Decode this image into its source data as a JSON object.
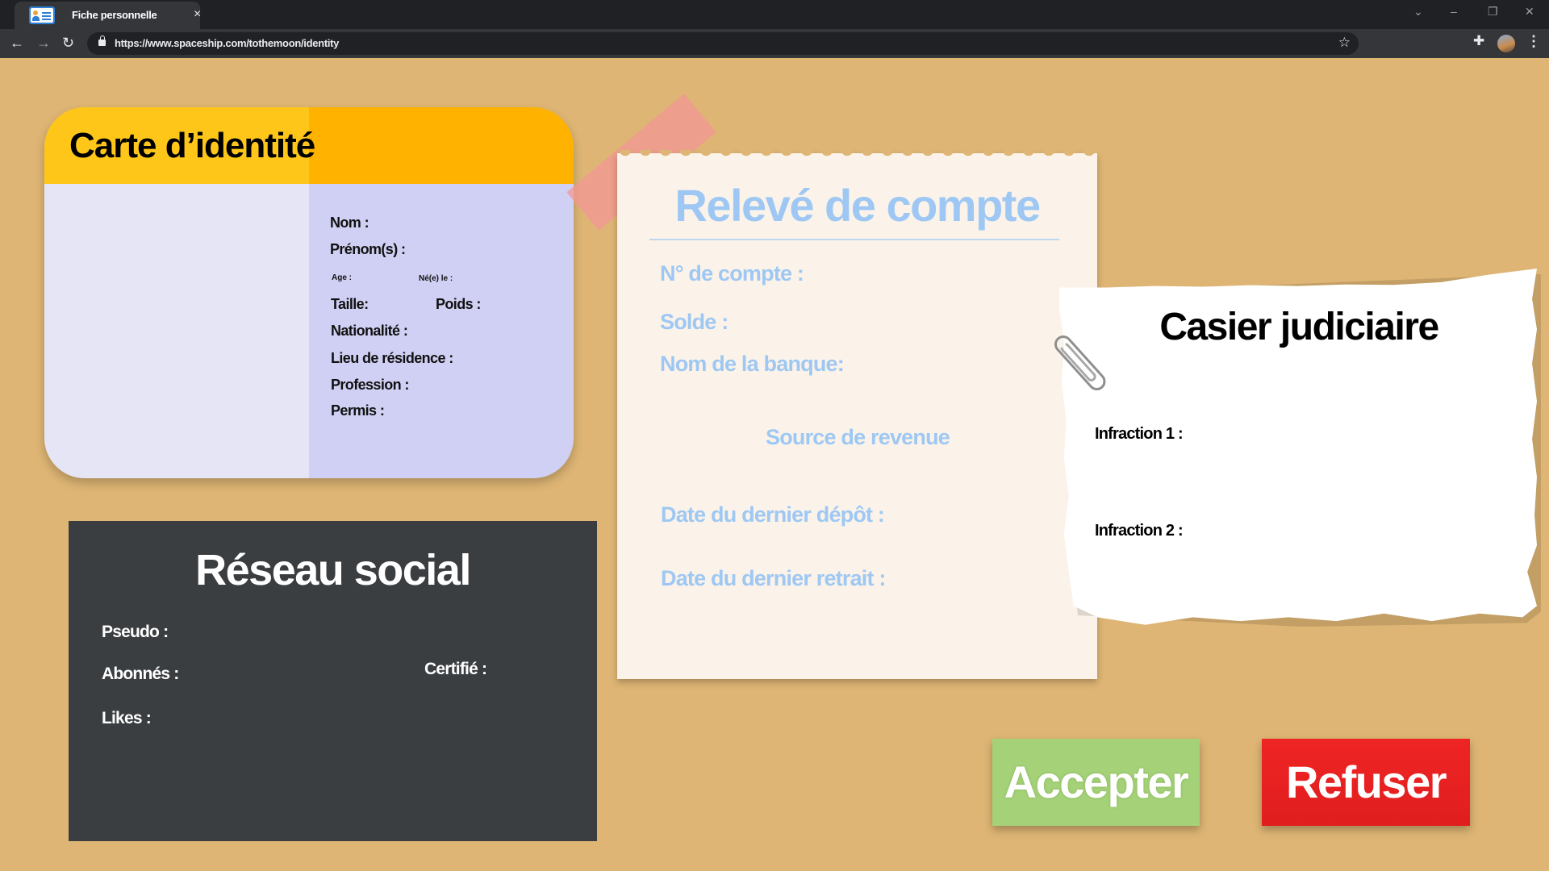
{
  "browser": {
    "tab_title": "Fiche personnelle",
    "tab_close": "×",
    "url": "https://www.spaceship.com/tothemoon/identity",
    "window_controls": {
      "chevron": "⌄",
      "minimize": "–",
      "restore": "❐",
      "close": "✕"
    },
    "nav": {
      "back": "←",
      "forward": "→",
      "reload": "↻"
    },
    "icons": {
      "star": "☆",
      "extensions": "✚",
      "menu": "⋮"
    }
  },
  "identity_card": {
    "title": "Carte d’identité",
    "labels": {
      "nom": "Nom :",
      "prenoms": "Prénom(s) :",
      "age": "Age :",
      "ne_le": "Né(e) le :",
      "taille": "Taille:",
      "poids": "Poids :",
      "nationalite": "Nationalité :",
      "lieu": "Lieu de résidence :",
      "profession": "Profession :",
      "permis": "Permis :"
    },
    "colors": {
      "header": "#ffc61a",
      "photo_bg": "#e6e5f5",
      "info_bg": "#d0d0f4"
    }
  },
  "social": {
    "title": "Réseau social",
    "labels": {
      "pseudo": "Pseudo :",
      "abonnes": "Abonnés :",
      "certifie": "Certifié :",
      "likes": "Likes :"
    },
    "colors": {
      "background": "#3b3e41"
    }
  },
  "bank_statement": {
    "title": "Relevé de compte",
    "labels": {
      "numero": "N° de compte :",
      "solde": "Solde :",
      "banque": "Nom de la banque:",
      "source": "Source de revenue",
      "depot": "Date du dernier dépôt :",
      "retrait": "Date du dernier retrait :"
    },
    "colors": {
      "text": "#9ec8f3",
      "paper": "#fbf3ea"
    }
  },
  "criminal_record": {
    "title": "Casier judiciaire",
    "labels": {
      "infraction1": "Infraction 1 :",
      "infraction2": "Infraction 2 :"
    }
  },
  "actions": {
    "accept": "Accepter",
    "refuse": "Refuser",
    "colors": {
      "accept": "#a5d278",
      "refuse": "#e01e1e"
    }
  },
  "page": {
    "background": "#deb574"
  }
}
